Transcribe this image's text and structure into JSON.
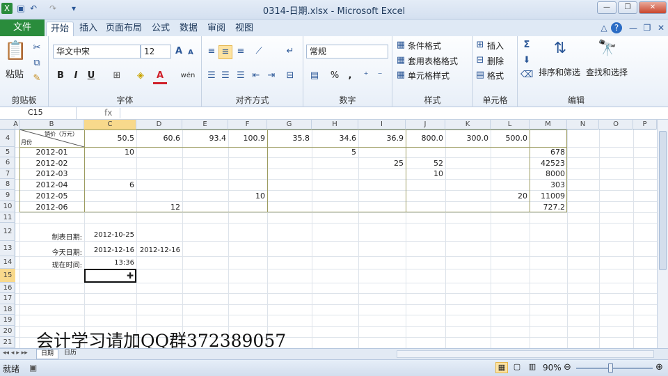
{
  "window": {
    "title": "0314-日期.xlsx - Microsoft Excel"
  },
  "tabs": {
    "file": "文件",
    "items": [
      "开始",
      "插入",
      "页面布局",
      "公式",
      "数据",
      "审阅",
      "视图"
    ]
  },
  "ribbon": {
    "clipboard": {
      "label": "剪贴板",
      "paste": "粘贴"
    },
    "font": {
      "label": "字体",
      "name": "华文中宋",
      "size": "12",
      "bold": "B",
      "italic": "I",
      "underline": "U",
      "grow": "A",
      "shrink": "A",
      "wen": "wén"
    },
    "align": {
      "label": "对齐方式"
    },
    "number": {
      "label": "数字",
      "format": "常规",
      "percent": "%",
      "comma": ","
    },
    "styles": {
      "label": "样式",
      "cond": "条件格式",
      "table": "套用表格格式",
      "cell": "单元格样式"
    },
    "cells": {
      "label": "单元格",
      "insert": "插入",
      "delete": "删除",
      "format": "格式"
    },
    "edit": {
      "label": "编辑",
      "sort": "排序和筛选",
      "find": "查找和选择",
      "sigma": "Σ"
    }
  },
  "formula_bar": {
    "cell": "C15",
    "fx": "fx"
  },
  "columns": [
    "A",
    "B",
    "C",
    "D",
    "E",
    "F",
    "G",
    "H",
    "I",
    "J",
    "K",
    "L",
    "M",
    "N",
    "O",
    "P"
  ],
  "rows": [
    "4",
    "5",
    "6",
    "7",
    "8",
    "9",
    "10",
    "11",
    "12",
    "13",
    "14",
    "15",
    "16",
    "17",
    "18",
    "19",
    "20",
    "21"
  ],
  "sheet": {
    "header_top": "销价（万元）",
    "header_bottom": "月份",
    "prices": [
      "50.5",
      "60.6",
      "93.4",
      "100.9",
      "35.8",
      "34.6",
      "36.9",
      "800.0",
      "300.0",
      "500.0"
    ],
    "months": [
      "2012-01",
      "2012-02",
      "2012-03",
      "2012-04",
      "2012-05",
      "2012-06"
    ],
    "values": [
      {
        "row": 0,
        "col": "C",
        "v": "10"
      },
      {
        "row": 0,
        "col": "H",
        "v": "5"
      },
      {
        "row": 0,
        "col": "M",
        "v": "678"
      },
      {
        "row": 1,
        "col": "I",
        "v": "25"
      },
      {
        "row": 1,
        "col": "J",
        "v": "52"
      },
      {
        "row": 1,
        "col": "M",
        "v": "42523"
      },
      {
        "row": 2,
        "col": "J",
        "v": "10"
      },
      {
        "row": 2,
        "col": "M",
        "v": "8000"
      },
      {
        "row": 3,
        "col": "C",
        "v": "6"
      },
      {
        "row": 3,
        "col": "M",
        "v": "303"
      },
      {
        "row": 4,
        "col": "F",
        "v": "10"
      },
      {
        "row": 4,
        "col": "L",
        "v": "20"
      },
      {
        "row": 4,
        "col": "M",
        "v": "11009"
      },
      {
        "row": 5,
        "col": "D",
        "v": "12"
      },
      {
        "row": 5,
        "col": "M",
        "v": "727.2"
      }
    ],
    "make_date_label": "制表日期:",
    "make_date": "2012-10-25",
    "today_label": "今天日期:",
    "today_c": "2012-12-16",
    "today_d": "2012-12-16",
    "now_label": "现在时间:",
    "now_time": "13:36"
  },
  "sheet_tabs": [
    "日期",
    "日历"
  ],
  "status": {
    "ready": "就绪",
    "zoom": "90%"
  },
  "watermark": "会计学习请加QQ群372389057"
}
